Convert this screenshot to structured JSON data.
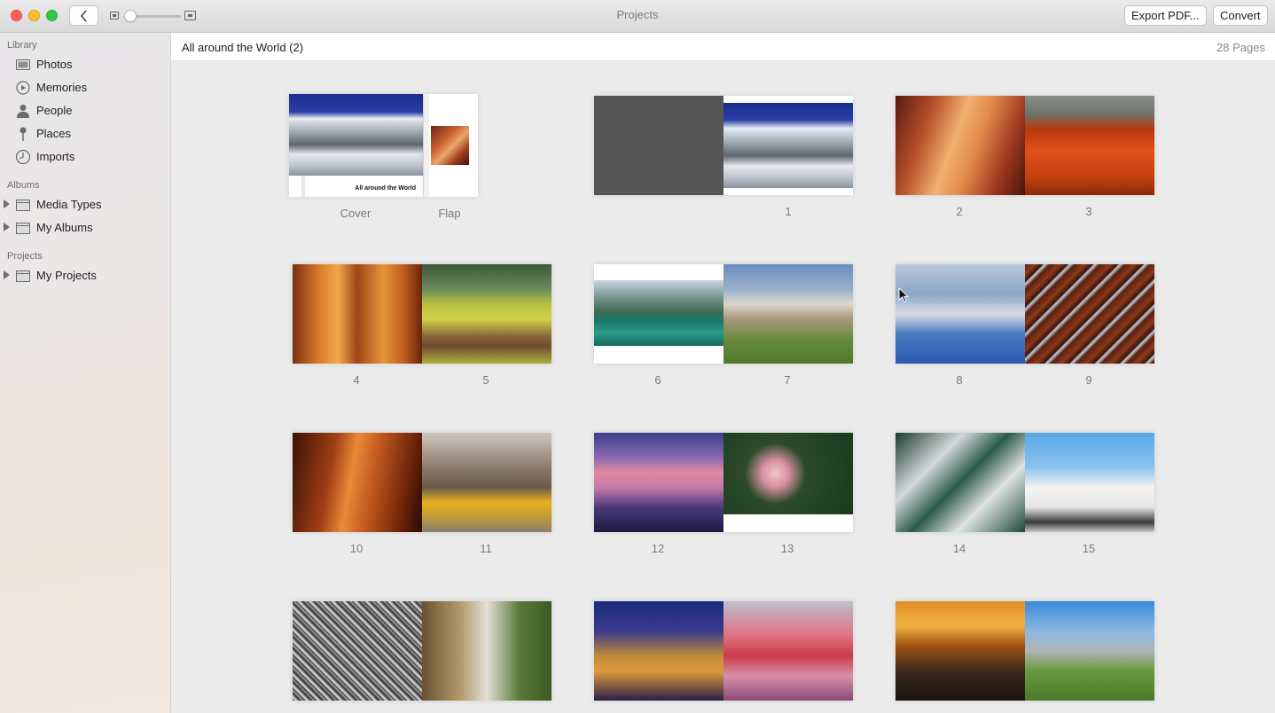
{
  "window": {
    "title": "Projects",
    "export_label": "Export PDF...",
    "convert_label": "Convert"
  },
  "sidebar": {
    "library_title": "Library",
    "library": [
      {
        "label": "Photos",
        "icon": "photos-icon"
      },
      {
        "label": "Memories",
        "icon": "memories-icon"
      },
      {
        "label": "People",
        "icon": "people-icon"
      },
      {
        "label": "Places",
        "icon": "places-icon"
      },
      {
        "label": "Imports",
        "icon": "imports-icon"
      }
    ],
    "albums_title": "Albums",
    "albums": [
      {
        "label": "Media Types",
        "icon": "folder-icon"
      },
      {
        "label": "My Albums",
        "icon": "folder-icon"
      }
    ],
    "projects_title": "Projects",
    "projects": [
      {
        "label": "My Projects",
        "icon": "folder-icon"
      }
    ]
  },
  "main": {
    "project_title": "All around the World (2)",
    "page_count": "28 Pages",
    "cover_text": "All around the World",
    "cover_label": "Cover",
    "flap_label": "Flap",
    "captions": [
      "1",
      "2",
      "3",
      "4",
      "5",
      "6",
      "7",
      "8",
      "9",
      "10",
      "11",
      "12",
      "13",
      "14",
      "15"
    ]
  }
}
